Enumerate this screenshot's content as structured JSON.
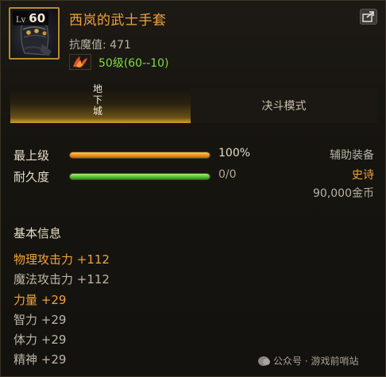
{
  "item": {
    "level_label": "Lv",
    "level": "60",
    "name": "西岚的武士手套",
    "magic_resistance": "抗魔值: 471",
    "level_range": "50级(60--10)"
  },
  "tabs": {
    "dungeon": "地下城",
    "duel": "决斗模式"
  },
  "stats": {
    "upgrade": {
      "label": "最上级",
      "value": "100%",
      "fill": 1.0
    },
    "durability": {
      "label": "耐久度",
      "value": "0/0",
      "fill": 1.0
    }
  },
  "side_info": {
    "equip_type": "辅助装备",
    "rarity": "史诗",
    "price": "90,000金币"
  },
  "basic_info": {
    "title": "基本信息",
    "attributes": [
      "物理攻击力 +112",
      "魔法攻击力 +112",
      "力量 +29",
      "智力 +29",
      "体力 +29",
      "精神 +29"
    ]
  },
  "watermark": {
    "text": "公众号 · 游戏前哨站"
  },
  "colors": {
    "title_orange": "#f2a23a",
    "level_green": "#7fdc48",
    "rarity_orange": "#f2a23a"
  }
}
